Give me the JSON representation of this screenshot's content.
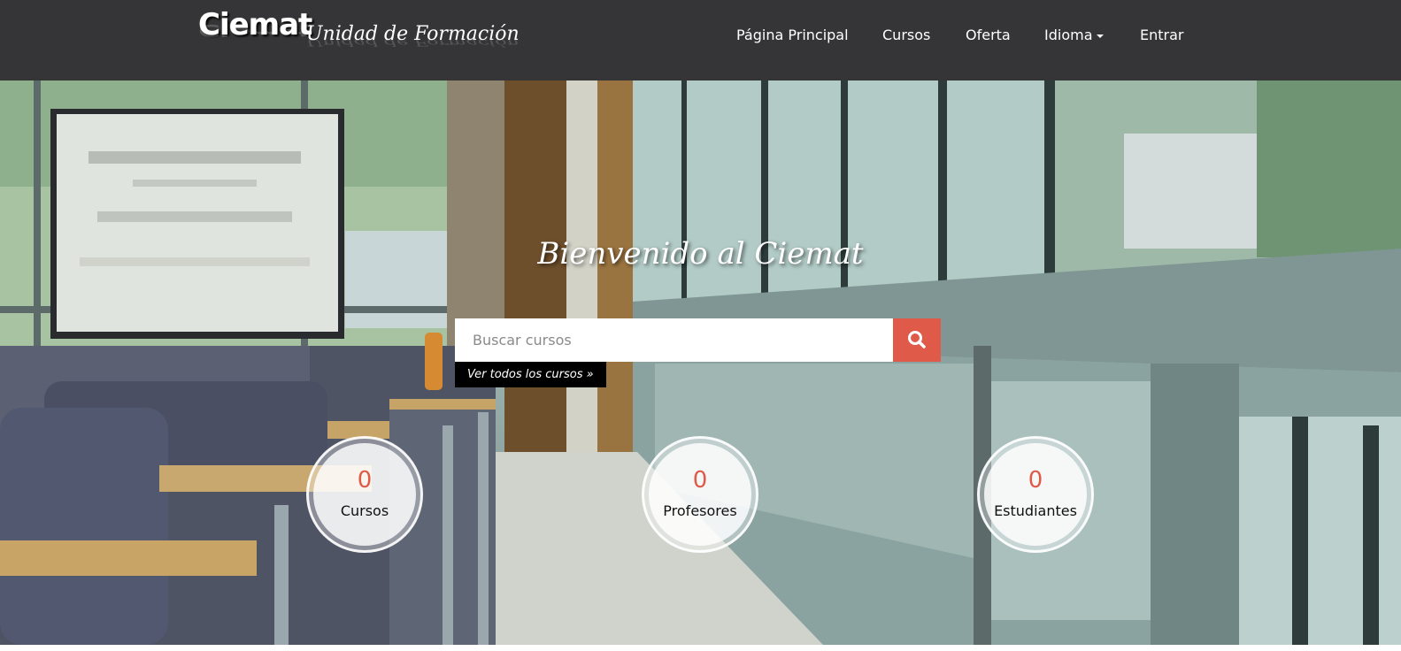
{
  "header": {
    "logo": {
      "brand": "Ciemat",
      "subtitle": "Unidad de Formación"
    },
    "nav": [
      {
        "label": "Página Principal"
      },
      {
        "label": "Cursos"
      },
      {
        "label": "Oferta"
      },
      {
        "label": "Idioma",
        "has_dropdown": true
      },
      {
        "label": "Entrar"
      }
    ]
  },
  "hero": {
    "title": "Bienvenido al Ciemat",
    "search": {
      "placeholder": "Buscar cursos",
      "button_icon": "search-icon"
    },
    "all_courses_link": "Ver todos los cursos »",
    "stats": [
      {
        "value": "0",
        "label": "Cursos"
      },
      {
        "value": "0",
        "label": "Profesores"
      },
      {
        "value": "0",
        "label": "Estudiantes"
      }
    ]
  },
  "colors": {
    "header_bg": "#353537",
    "accent": "#e05a4a",
    "link_bg": "#000000"
  }
}
